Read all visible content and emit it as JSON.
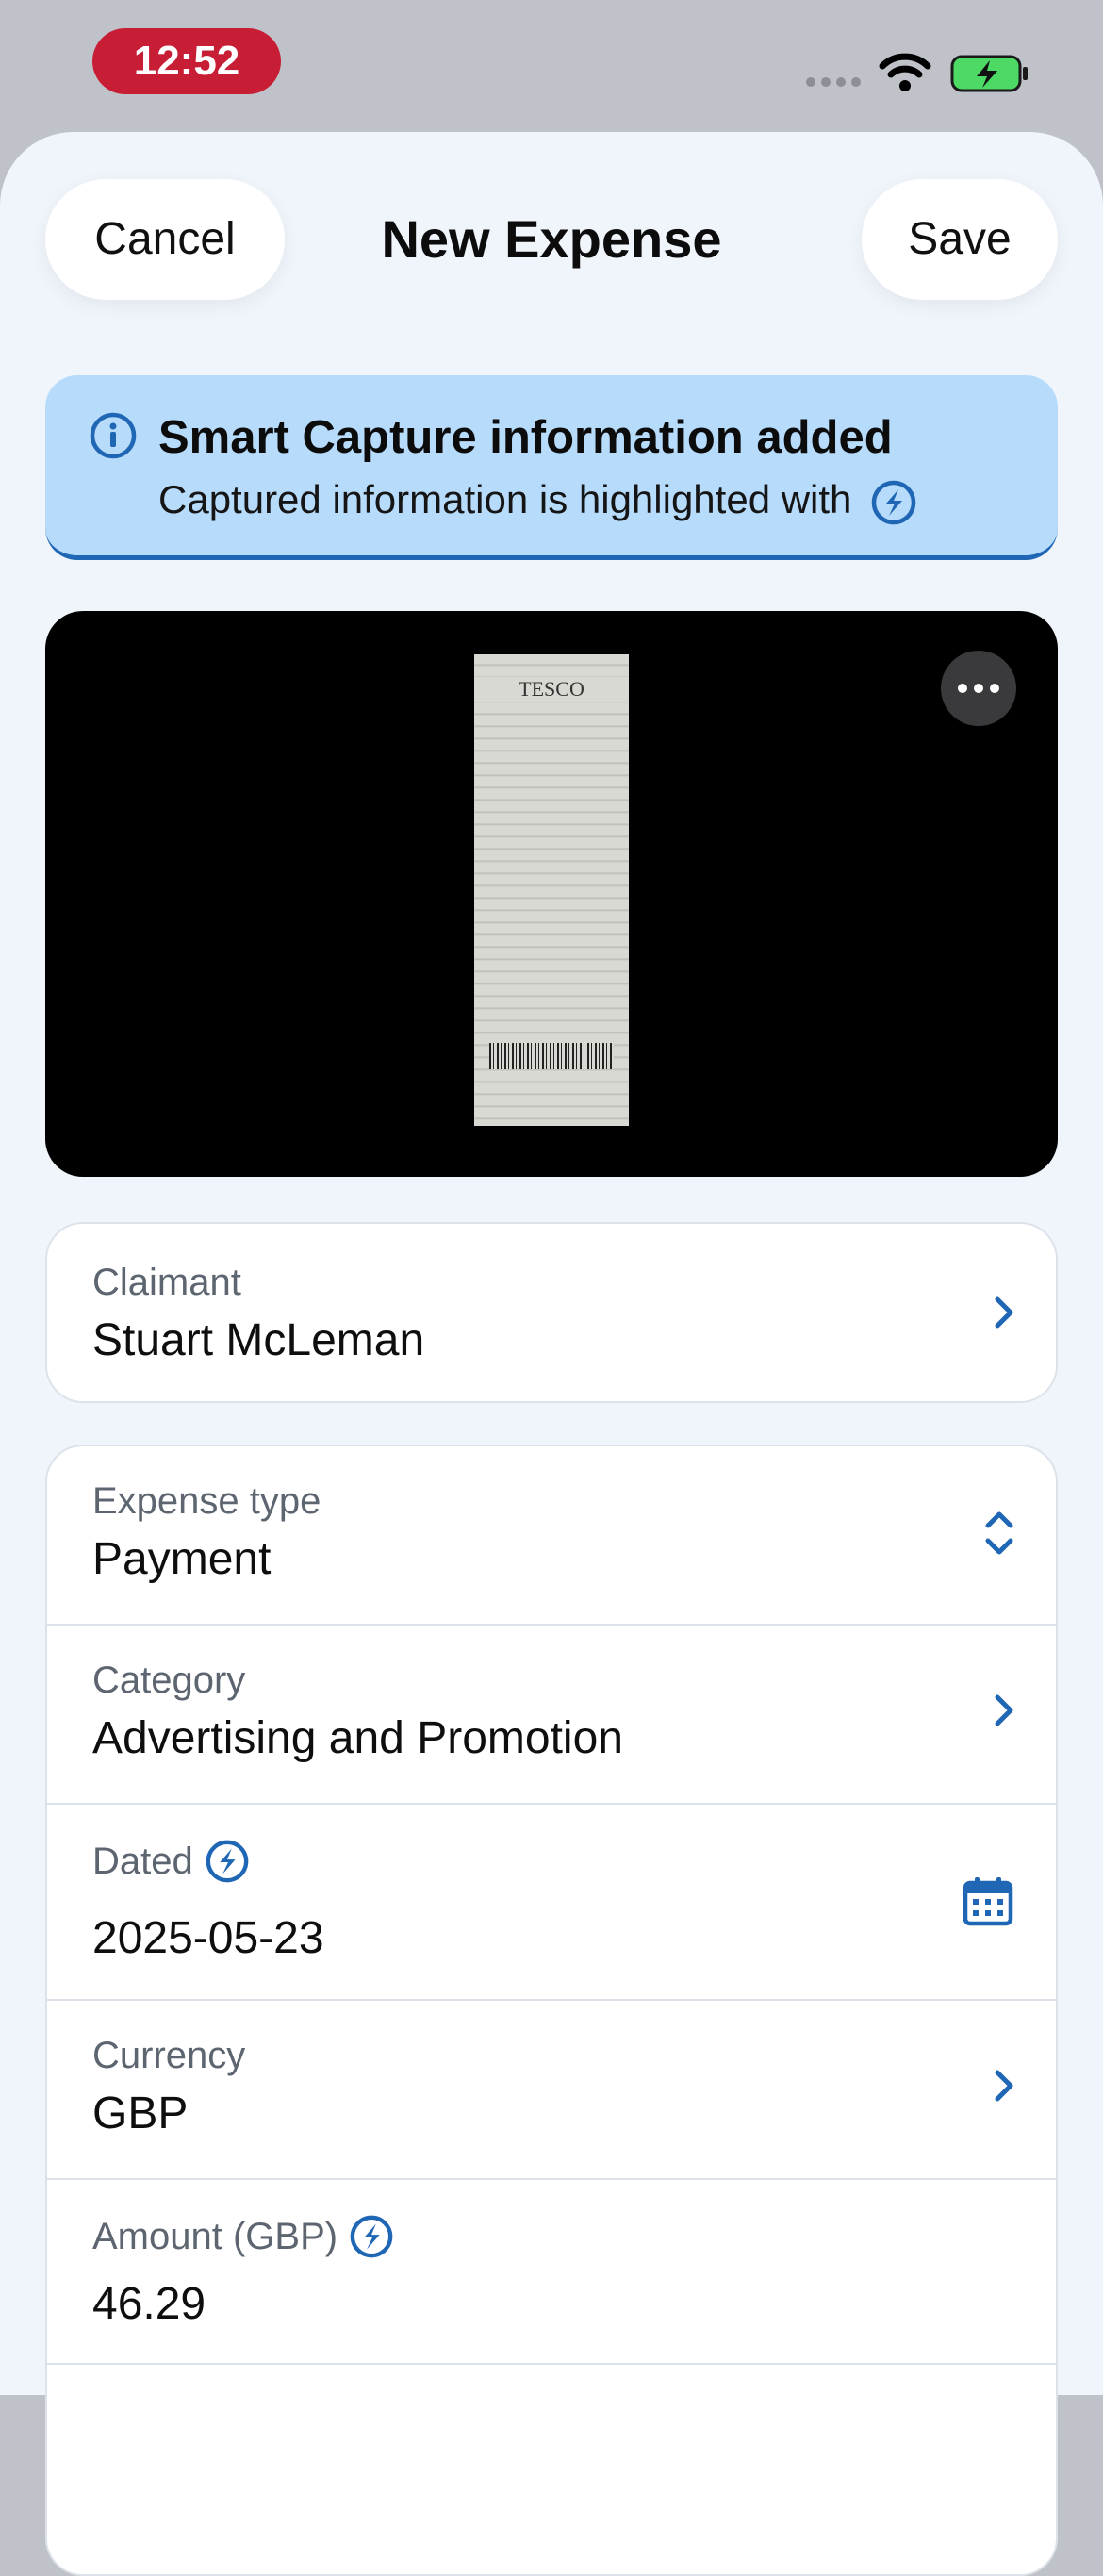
{
  "status_bar": {
    "time": "12:52"
  },
  "header": {
    "cancel_label": "Cancel",
    "title": "New Expense",
    "save_label": "Save"
  },
  "banner": {
    "title": "Smart Capture information added",
    "text": "Captured information is highlighted with"
  },
  "receipt": {
    "logo_text": "TESCO"
  },
  "claimant": {
    "label": "Claimant",
    "value": "Stuart McLeman"
  },
  "fields": {
    "expense_type": {
      "label": "Expense type",
      "value": "Payment"
    },
    "category": {
      "label": "Category",
      "value": "Advertising and Promotion"
    },
    "dated": {
      "label": "Dated",
      "value": "2025-05-23"
    },
    "currency": {
      "label": "Currency",
      "value": "GBP"
    },
    "amount": {
      "label": "Amount (GBP)",
      "value": "46.29"
    }
  },
  "colors": {
    "accent": "#1f66b4",
    "status_pill": "#c81e35",
    "banner_bg": "#b7dbfb",
    "battery": "#4cd964"
  },
  "icons": [
    "info-icon",
    "smart-capture-icon",
    "more-icon",
    "chevron-right-icon",
    "chevron-up-down-icon",
    "calendar-icon",
    "wifi-icon",
    "battery-charging-icon"
  ]
}
